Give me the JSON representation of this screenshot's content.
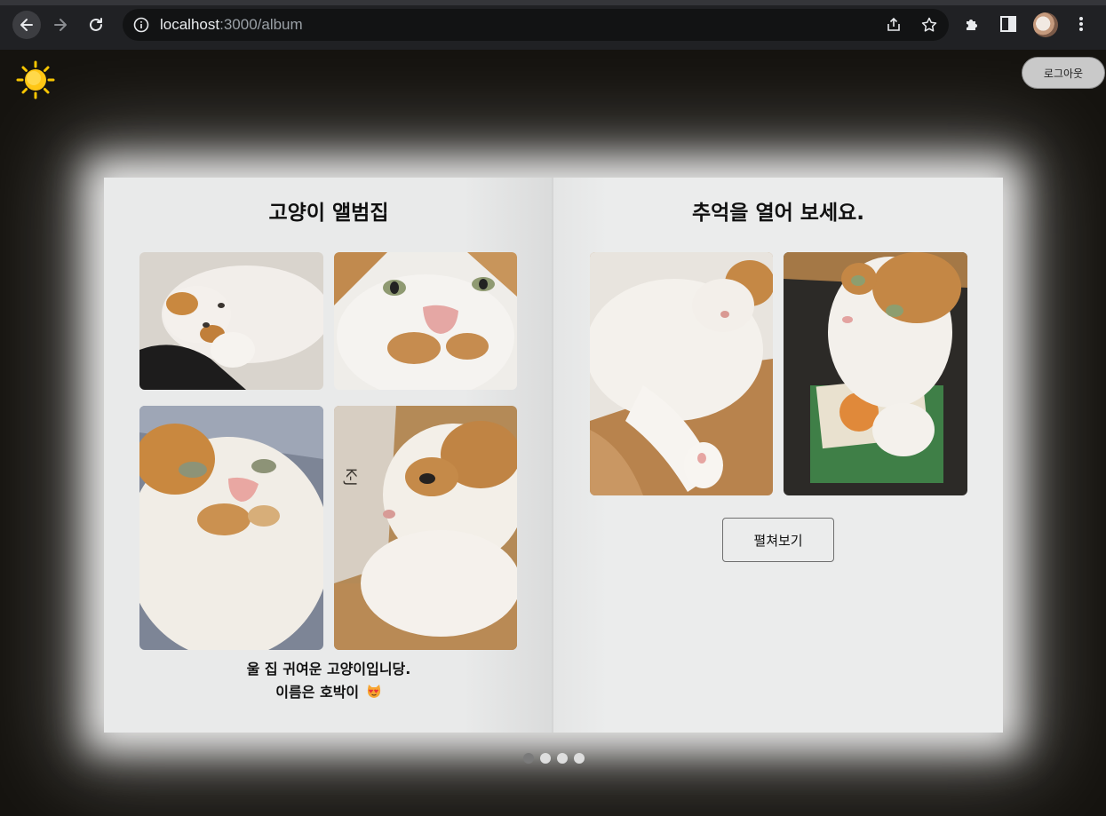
{
  "browser": {
    "url_host": "localhost",
    "url_path": ":3000/album"
  },
  "header": {
    "logout_label": "로그아웃"
  },
  "album": {
    "left_page": {
      "title": "고양이 앨범집",
      "caption_line1": "울 집 귀여운 고양이입니당.",
      "caption_line2": "이름은 호박이"
    },
    "right_page": {
      "title": "추억을 열어 보세요.",
      "open_button_label": "펼쳐보기"
    }
  },
  "pagination": {
    "total": 4,
    "active_index": 0
  },
  "colors": {
    "page_bg": "#15130f",
    "book_bg": "#e9eaea",
    "chrome_bg": "#202124"
  }
}
